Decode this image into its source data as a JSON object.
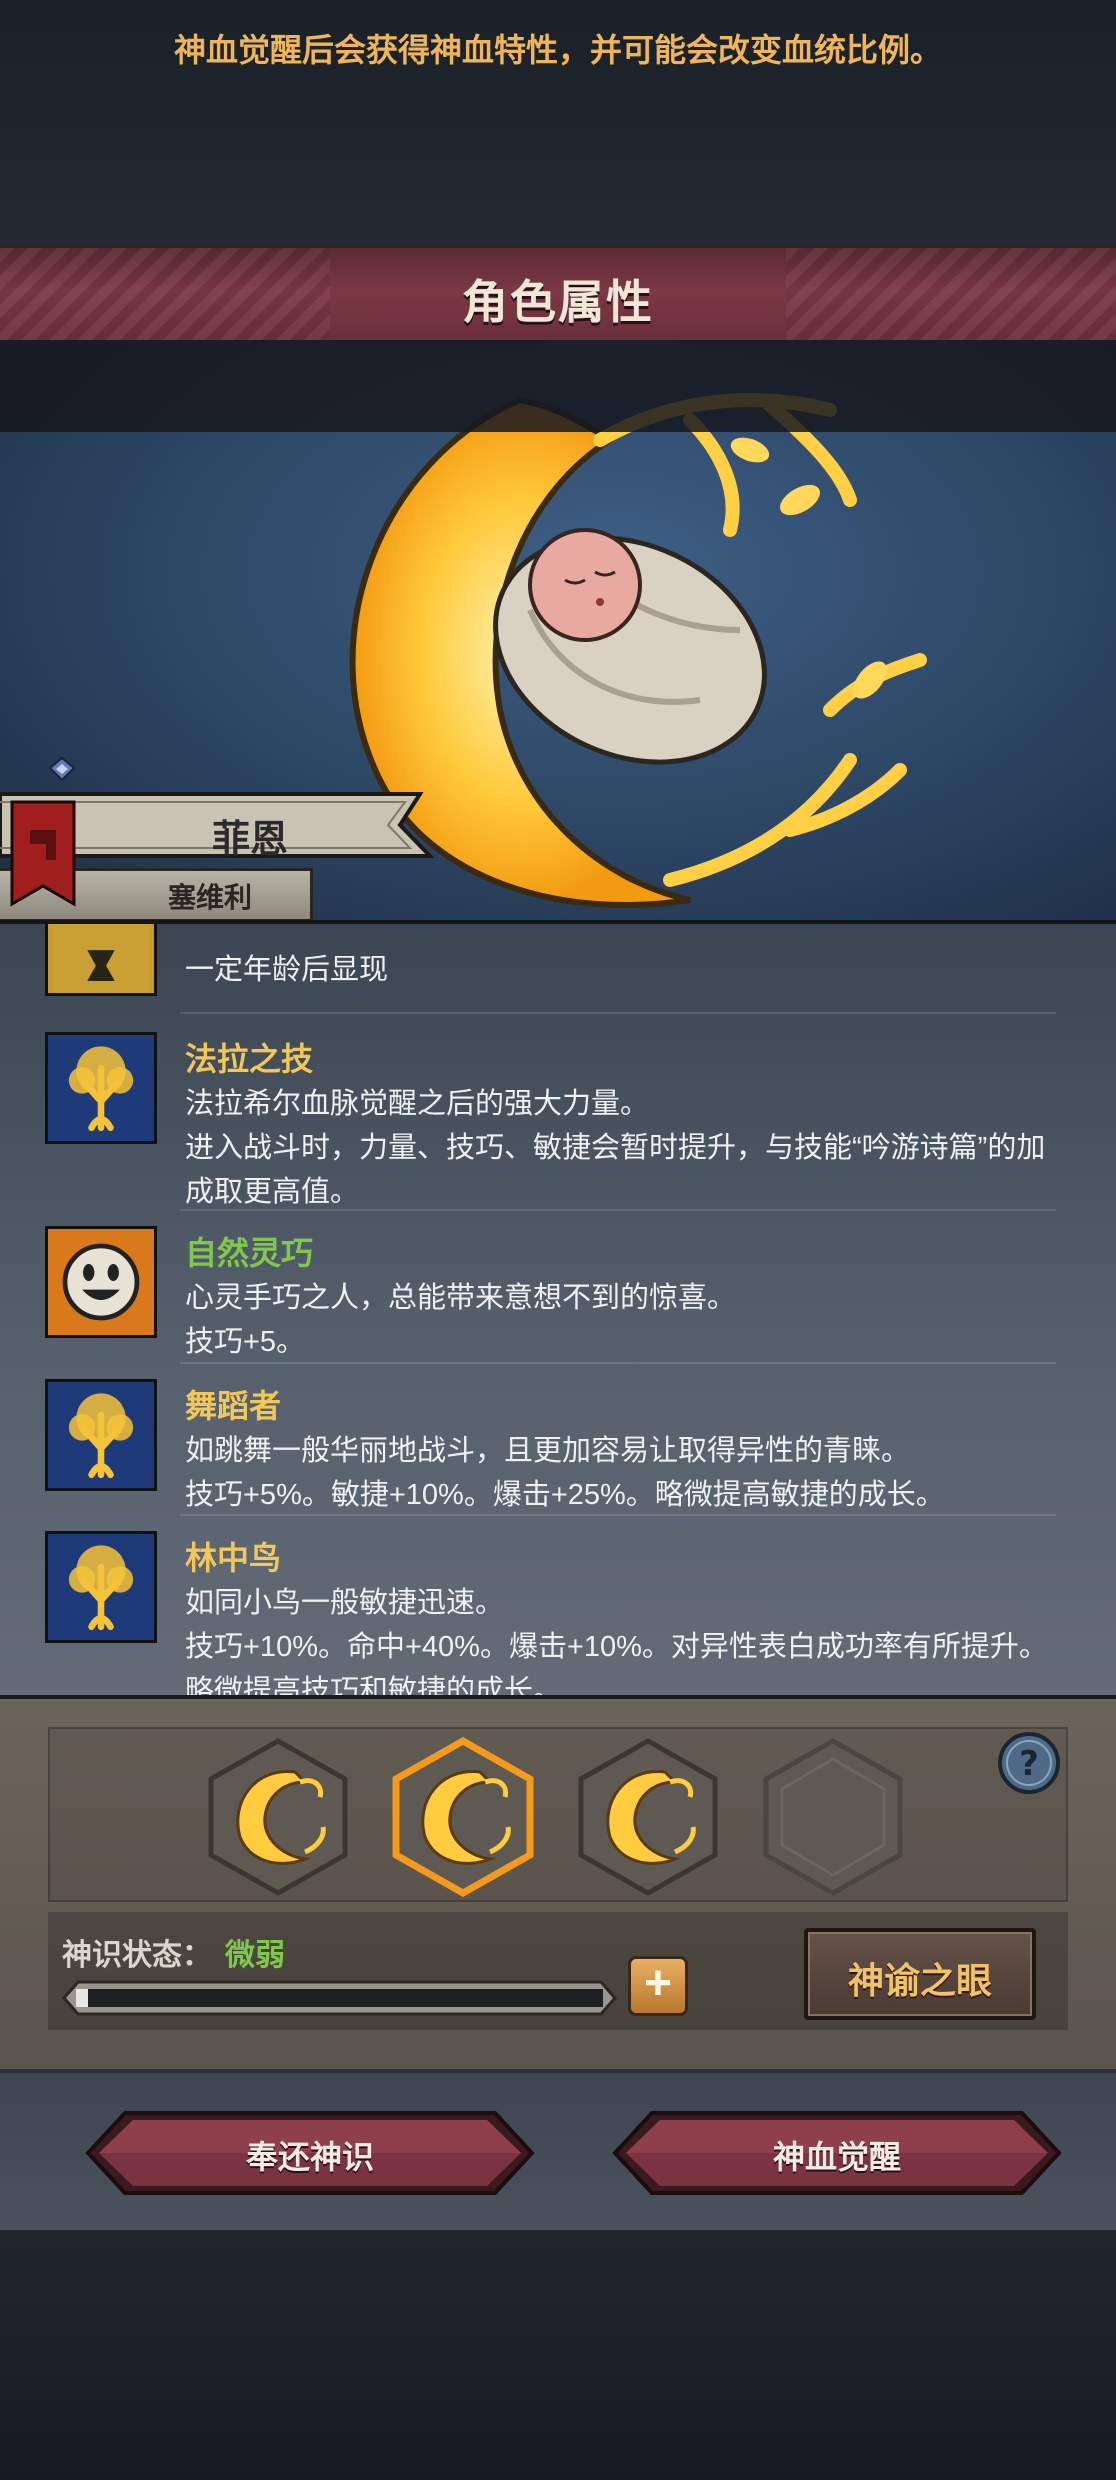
{
  "header": {
    "title": "角色属性"
  },
  "notice": {
    "text": "神血觉醒后会获得神血特性，并可能会改变血统比例。"
  },
  "character": {
    "name": "菲恩",
    "origin": "塞维利"
  },
  "traits": [
    {
      "name": "",
      "lines": [
        "一定年龄后显现"
      ],
      "icon": "hourglass-icon"
    },
    {
      "name": "法拉之技",
      "lines": [
        "法拉希尔血脉觉醒之后的强大力量。",
        "进入战斗时，力量、技巧、敏捷会暂时提升，与技能“吟游诗篇”的加",
        "成取更高值。"
      ],
      "icon": "golden-tree-icon"
    },
    {
      "name": "自然灵巧",
      "lines": [
        "心灵手巧之人，总能带来意想不到的惊喜。",
        "技巧+5。"
      ],
      "icon": "smiley-face-icon"
    },
    {
      "name": "舞蹈者",
      "lines": [
        "如跳舞一般华丽地战斗，且更加容易让取得异性的青睐。",
        "技巧+5%。敏捷+10%。爆击+25%。略微提高敏捷的成长。"
      ],
      "icon": "golden-tree-icon"
    },
    {
      "name": "林中鸟",
      "lines": [
        "如同小鸟一般敏捷迅速。",
        "技巧+10%。命中+40%。爆击+10%。对异性表白成功率有所提升。",
        "略微提高技巧和敏捷的成长。"
      ],
      "icon": "golden-tree-icon"
    }
  ],
  "awakening": {
    "state_label": "神识状态：",
    "state_value": "微弱",
    "progress": 0.02,
    "oracle_button": "神谕之眼",
    "slots": [
      {
        "filled": true,
        "selected": false
      },
      {
        "filled": true,
        "selected": true
      },
      {
        "filled": true,
        "selected": false
      },
      {
        "filled": false,
        "selected": false
      }
    ]
  },
  "actions": {
    "return_button": "奉还神识",
    "awaken_button": "神血觉醒"
  },
  "colors": {
    "gold": "#f2c75a",
    "green": "#7ec84b",
    "crimson": "#7b3944",
    "notice": "#f0b55a"
  }
}
